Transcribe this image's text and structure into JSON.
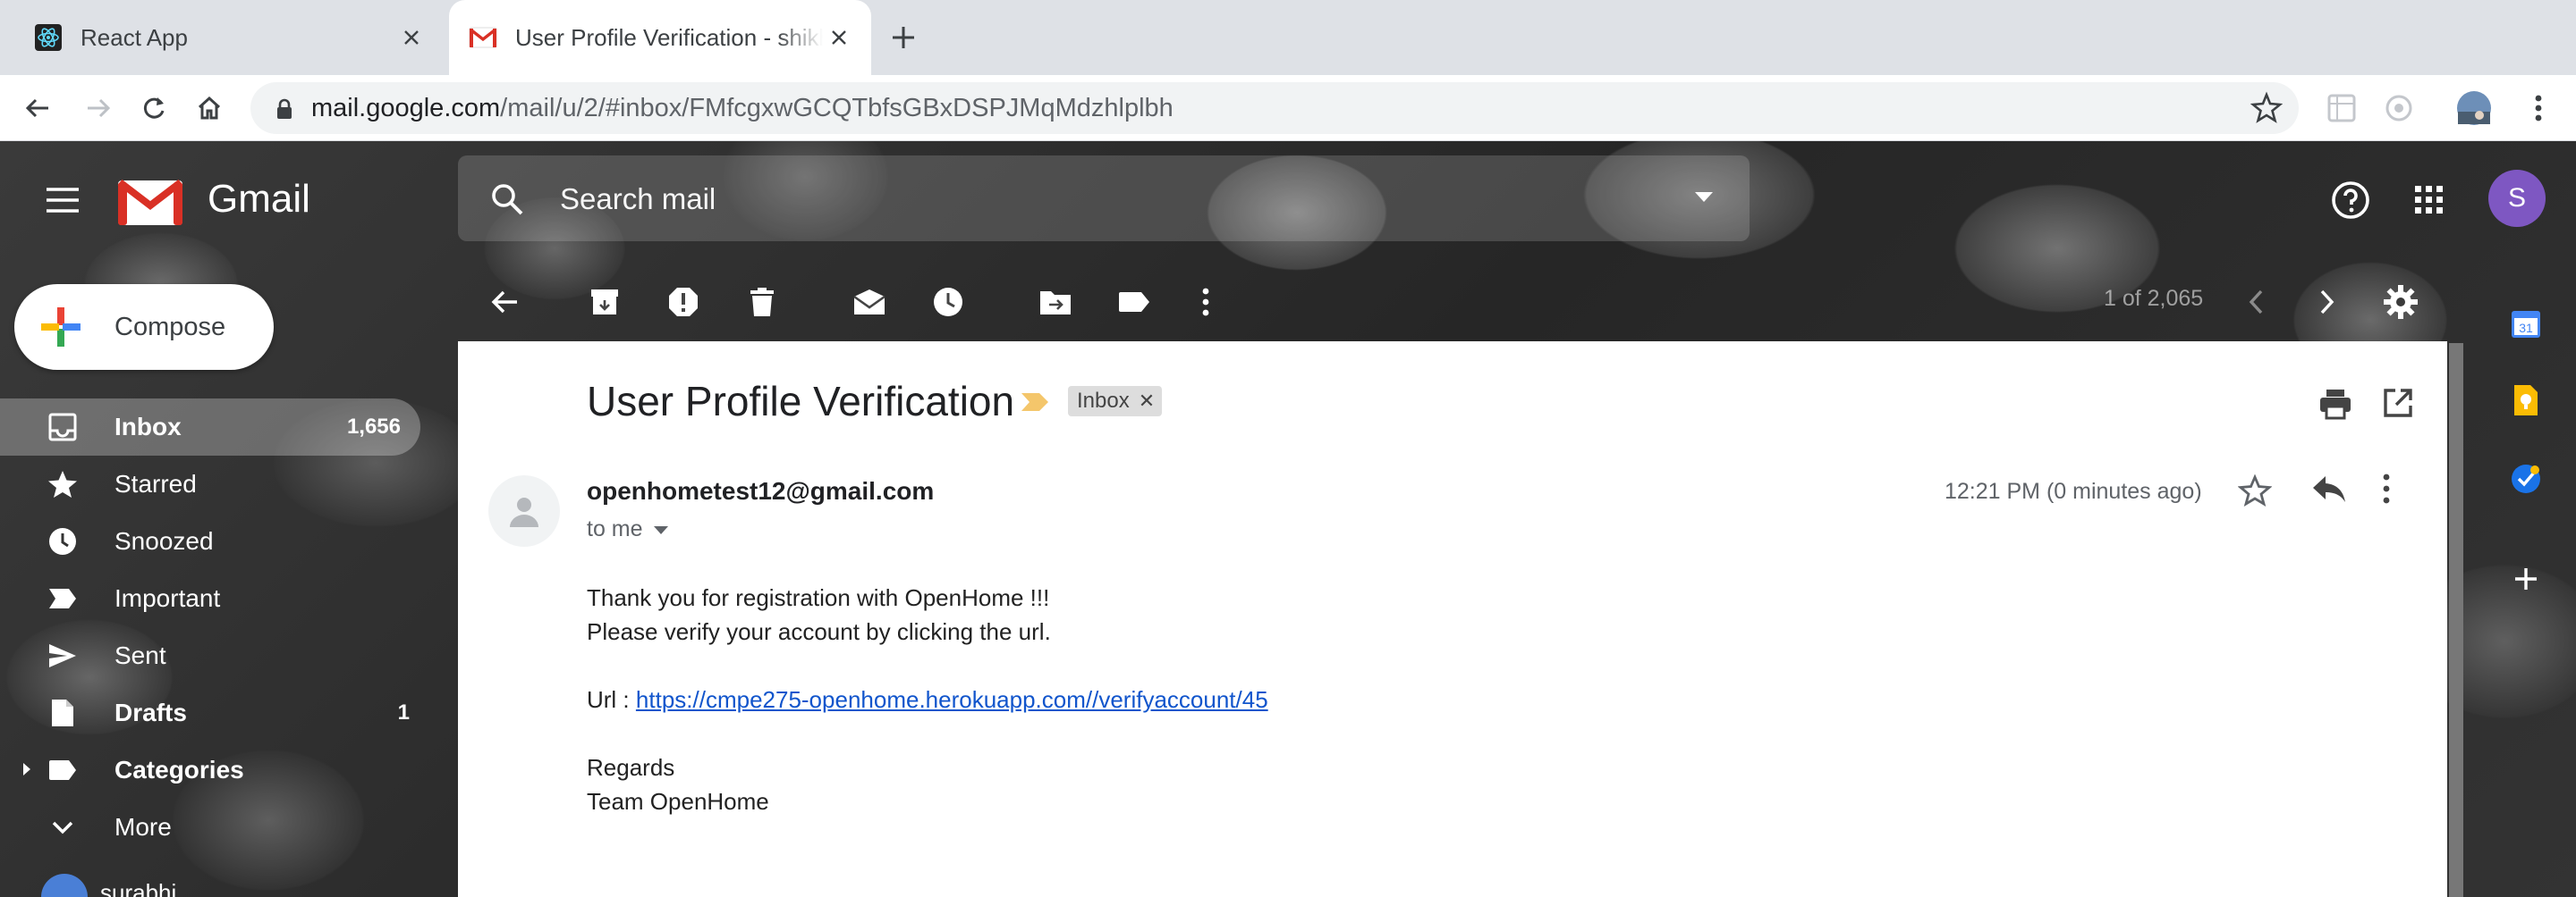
{
  "browser": {
    "tabs": [
      {
        "title": "React App",
        "favicon": "react-icon"
      },
      {
        "title": "User Profile Verification - shikha.stacy@gmail.com - Gmail",
        "favicon": "gmail-icon"
      }
    ],
    "url_host": "mail.google.com",
    "url_path": "/mail/u/2/#inbox/FMfcgxwGCQTbfsGBxDSPJMqMdzhlplbh"
  },
  "gmail": {
    "brand": "Gmail",
    "search_placeholder": "Search mail",
    "account_initial": "S",
    "compose_label": "Compose",
    "nav": [
      {
        "label": "Inbox",
        "count": "1,656",
        "icon": "inbox-icon"
      },
      {
        "label": "Starred",
        "count": "",
        "icon": "star-icon"
      },
      {
        "label": "Snoozed",
        "count": "",
        "icon": "clock-icon"
      },
      {
        "label": "Important",
        "count": "",
        "icon": "important-icon"
      },
      {
        "label": "Sent",
        "count": "",
        "icon": "send-icon"
      },
      {
        "label": "Drafts",
        "count": "1",
        "icon": "draft-icon"
      },
      {
        "label": "Categories",
        "count": "",
        "icon": "label-icon"
      },
      {
        "label": "More",
        "count": "",
        "icon": "chevron-down-icon"
      }
    ],
    "user_name": "surabhi",
    "pager": "1 of 2,065"
  },
  "message": {
    "subject": "User Profile Verification",
    "label": "Inbox",
    "sender": "openhometest12@gmail.com",
    "recipient": "to me",
    "time": "12:21 PM (0 minutes ago)",
    "body": {
      "line1": "Thank you for registration with OpenHome !!!",
      "line2": "Please verify your account by clicking the url.",
      "url_prefix": "Url :",
      "url": "https://cmpe275-openhome.herokuapp.com//verifyaccount/45",
      "regards": "Regards",
      "team": "Team OpenHome"
    }
  },
  "colors": {
    "accent_purple": "#7e57c2",
    "link_blue": "#1155cc",
    "importance_yellow": "#f4c66b"
  }
}
